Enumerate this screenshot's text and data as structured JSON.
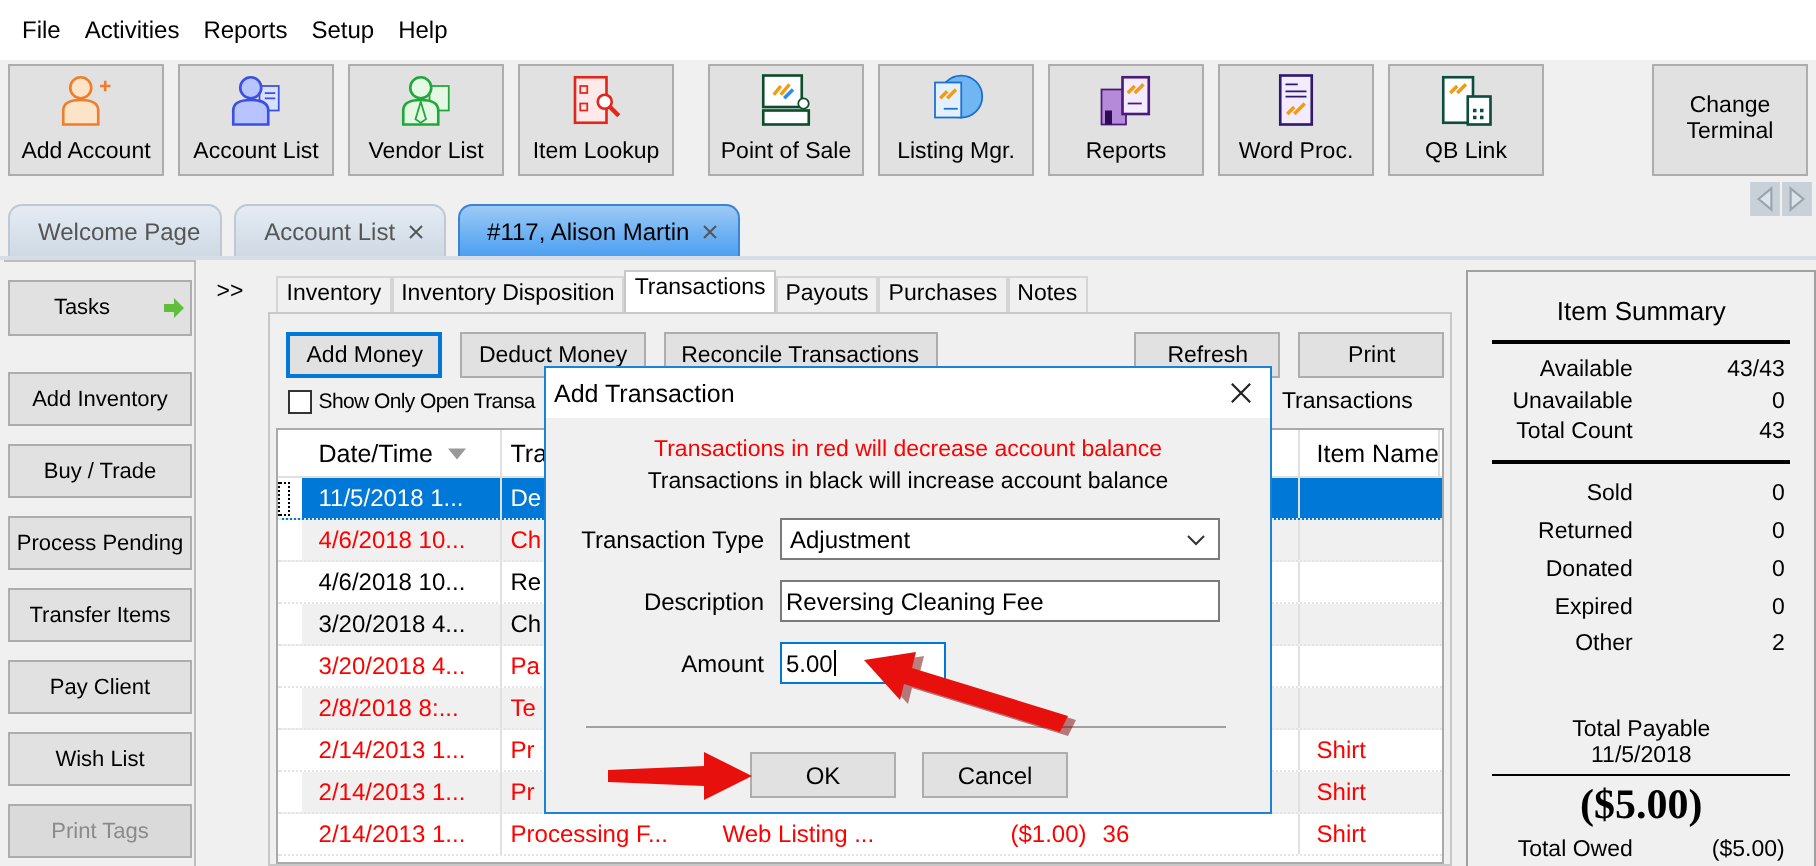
{
  "menu": [
    "File",
    "Activities",
    "Reports",
    "Setup",
    "Help"
  ],
  "toolbar": [
    {
      "label": "Add Account"
    },
    {
      "label": "Account List"
    },
    {
      "label": "Vendor List"
    },
    {
      "label": "Item Lookup"
    },
    {
      "label": "Point of Sale"
    },
    {
      "label": "Listing Mgr."
    },
    {
      "label": "Reports"
    },
    {
      "label": "Word Proc."
    },
    {
      "label": "QB Link"
    }
  ],
  "terminal_button": "Change Terminal",
  "doc_tabs": [
    {
      "label": "Welcome Page",
      "closable": false,
      "selected": false
    },
    {
      "label": "Account List",
      "closable": true,
      "selected": false
    },
    {
      "label": "#117, Alison Martin",
      "closable": true,
      "selected": true
    }
  ],
  "tasks": "Tasks",
  "sidebar_buttons": [
    {
      "label": "Add Inventory",
      "disabled": false
    },
    {
      "label": "Buy / Trade",
      "disabled": false
    },
    {
      "label": "Process Pending",
      "disabled": false
    },
    {
      "label": "Transfer Items",
      "disabled": false
    },
    {
      "label": "Pay Client",
      "disabled": false
    },
    {
      "label": "Wish List",
      "disabled": false
    },
    {
      "label": "Print Tags",
      "disabled": true
    }
  ],
  "expander": ">>",
  "sub_tabs": [
    {
      "label": "Inventory",
      "selected": false
    },
    {
      "label": "Inventory Disposition",
      "selected": false
    },
    {
      "label": "Transactions",
      "selected": true
    },
    {
      "label": "Payouts",
      "selected": false
    },
    {
      "label": "Purchases",
      "selected": false
    },
    {
      "label": "Notes",
      "selected": false
    }
  ],
  "actions_left": [
    {
      "label": "Add Money",
      "focused": true
    },
    {
      "label": "Deduct Money",
      "focused": false
    },
    {
      "label": "Reconcile Transactions",
      "focused": false
    }
  ],
  "actions_right": [
    "Refresh",
    "Print"
  ],
  "filter": {
    "label": "Show Only Open Transa",
    "checked": false
  },
  "filter_right": "Transactions",
  "table": {
    "columns": {
      "date": "Date/Time",
      "type": "Tra",
      "item": "Item Name"
    },
    "rows": [
      {
        "date": "11/5/2018 1...",
        "type": "De",
        "negative": false,
        "selected": true
      },
      {
        "date": "4/6/2018 10...",
        "type": "Ch",
        "negative": true,
        "selected": false
      },
      {
        "date": "4/6/2018 10...",
        "type": "Re",
        "negative": false,
        "selected": false
      },
      {
        "date": "3/20/2018 4...",
        "type": "Ch",
        "negative": false,
        "selected": false
      },
      {
        "date": "3/20/2018 4...",
        "type": "Pa",
        "negative": true,
        "selected": false
      },
      {
        "date": "2/8/2018 8:...",
        "type": "Te",
        "negative": true,
        "selected": false
      },
      {
        "date": "2/14/2013 1...",
        "type": "Pr",
        "item": "Shirt",
        "negative": true,
        "selected": false
      },
      {
        "date": "2/14/2013 1...",
        "type": "Pr",
        "item": "Shirt",
        "negative": true,
        "selected": false
      },
      {
        "date": "2/14/2013 1...",
        "type": "Processing F...",
        "description": "Web Listing ...",
        "amount": "($1.00)",
        "number": "36",
        "item": "Shirt",
        "negative": true,
        "selected": false
      }
    ]
  },
  "dialog": {
    "title": "Add Transaction",
    "notes": [
      {
        "text": "Transactions in red will decrease account balance",
        "negative": true
      },
      {
        "text": "Transactions in black will increase account balance",
        "negative": false
      }
    ],
    "fields": [
      {
        "kind": "select",
        "label": "Transaction Type",
        "value": "Adjustment",
        "focused": false
      },
      {
        "kind": "text",
        "label": "Description",
        "value": "Reversing Cleaning Fee",
        "focused": false
      },
      {
        "kind": "short",
        "label": "Amount",
        "value": "5.00",
        "focused": true
      }
    ],
    "buttons": [
      "OK",
      "Cancel"
    ]
  },
  "summary": {
    "title": "Item Summary",
    "counts": [
      {
        "label": "Available",
        "value": "43/43"
      },
      {
        "label": "Unavailable",
        "value": "0"
      },
      {
        "label": "Total Count",
        "value": "43"
      }
    ],
    "statuses": [
      {
        "label": "Sold",
        "value": "0"
      },
      {
        "label": "Returned",
        "value": "0"
      },
      {
        "label": "Donated",
        "value": "0"
      },
      {
        "label": "Expired",
        "value": "0"
      },
      {
        "label": "Other",
        "value": "2"
      }
    ],
    "payable_label": "Total Payable",
    "payable_date": "11/5/2018",
    "payable_amount": "($5.00)",
    "owed": {
      "label": "Total Owed",
      "value": "($5.00)"
    }
  }
}
